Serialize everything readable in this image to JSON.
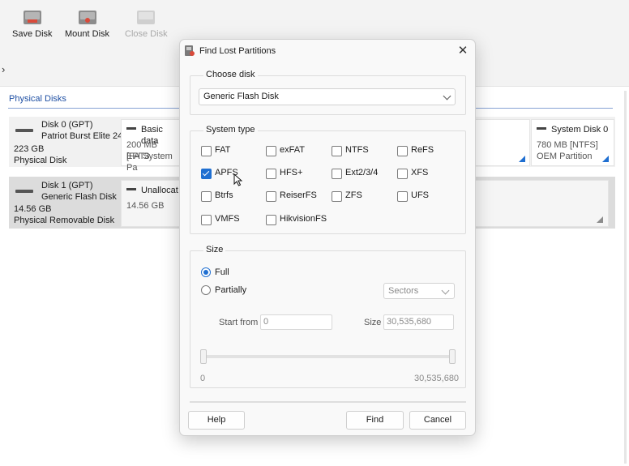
{
  "toolbar": {
    "save_disk": "Save Disk",
    "mount_disk": "Mount Disk",
    "close_disk": "Close Disk"
  },
  "breadcrumb": {
    "chevron": "›"
  },
  "physical_disks": {
    "label": "Physical Disks",
    "disks": [
      {
        "name": "Disk 0 (GPT)",
        "model": "Patriot Burst Elite 24",
        "size": "223 GB",
        "type": "Physical Disk",
        "partitions": [
          {
            "title": "Basic data",
            "line2": "200 MB [FAT3",
            "line3": "EFI System Pa"
          },
          {
            "title": "System Disk 0",
            "line2": "780 MB [NTFS]",
            "line3": "OEM Partition"
          }
        ]
      },
      {
        "name": "Disk 1 (GPT)",
        "model": "Generic Flash Disk",
        "size": "14.56 GB",
        "type": "Physical Removable Disk",
        "partitions": [
          {
            "title": "Unallocat",
            "line2": "14.56 GB"
          }
        ]
      }
    ]
  },
  "dialog": {
    "title": "Find Lost Partitions",
    "close_glyph": "✕",
    "choose_disk": {
      "label": "Choose disk",
      "selected": "Generic Flash Disk"
    },
    "system_type": {
      "label": "System type",
      "options": [
        {
          "label": "FAT",
          "checked": false
        },
        {
          "label": "exFAT",
          "checked": false
        },
        {
          "label": "NTFS",
          "checked": false
        },
        {
          "label": "ReFS",
          "checked": false
        },
        {
          "label": "APFS",
          "checked": true
        },
        {
          "label": "HFS+",
          "checked": false
        },
        {
          "label": "Ext2/3/4",
          "checked": false
        },
        {
          "label": "XFS",
          "checked": false
        },
        {
          "label": "Btrfs",
          "checked": false
        },
        {
          "label": "ReiserFS",
          "checked": false
        },
        {
          "label": "ZFS",
          "checked": false
        },
        {
          "label": "UFS",
          "checked": false
        },
        {
          "label": "VMFS",
          "checked": false
        },
        {
          "label": "HikvisionFS",
          "checked": false
        }
      ]
    },
    "size": {
      "label": "Size",
      "full_label": "Full",
      "partially_label": "Partially",
      "selected_mode": "Full",
      "unit": "Sectors",
      "start_from_label": "Start from",
      "start_from_value": "0",
      "size_label": "Size",
      "size_value": "30,535,680",
      "range_min": "0",
      "range_max": "30,535,680"
    },
    "buttons": {
      "help": "Help",
      "find": "Find",
      "cancel": "Cancel"
    }
  },
  "colors": {
    "accent": "#1f6fd1",
    "link": "#1e4fa3"
  }
}
